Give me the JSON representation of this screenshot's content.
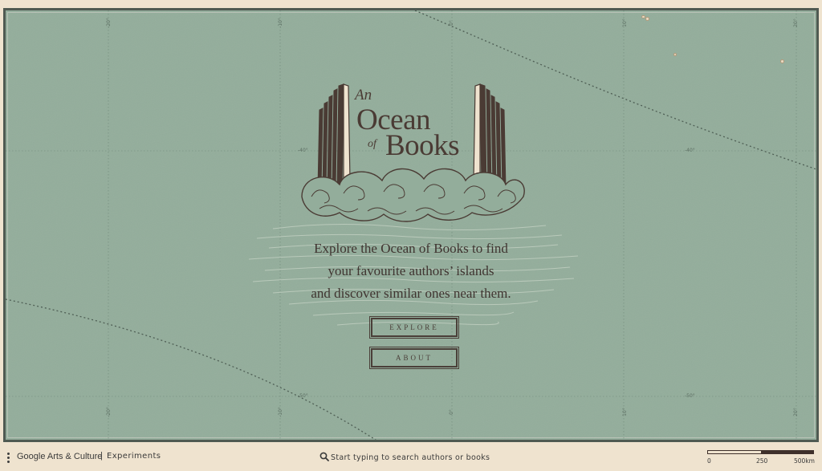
{
  "map": {
    "grid_labels_top": [
      "-20°",
      "-10°",
      "0°",
      "10°",
      "20°"
    ],
    "grid_labels_bottom": [
      "-20°",
      "-10°",
      "0°",
      "10°",
      "20°"
    ],
    "lat_labels_upper": [
      "-40°",
      "-40°"
    ],
    "lat_labels_lower": [
      "-50°",
      "-50°"
    ],
    "colors": {
      "sea": "#93ad9b",
      "ink": "#4a3b34",
      "paper": "#efe3cf"
    }
  },
  "logo": {
    "line1": "An",
    "line2": "Ocean",
    "line3": "of",
    "line4": "Books",
    "icon": "open-book-waves-icon"
  },
  "tagline": {
    "line1": "Explore the Ocean of Books to find",
    "line2": "your favourite authors’ islands",
    "line3": "and discover similar ones near them."
  },
  "buttons": {
    "explore": "EXPLORE",
    "about": "ABOUT"
  },
  "footer": {
    "menu_icon": "kebab-menu-icon",
    "brand": "Google Arts & Culture",
    "separator": "|",
    "experiments": "Experiments",
    "search_icon": "search-icon",
    "search_placeholder": "Start typing to search authors or books",
    "scale": {
      "labels": [
        "0",
        "250",
        "500km"
      ]
    }
  }
}
